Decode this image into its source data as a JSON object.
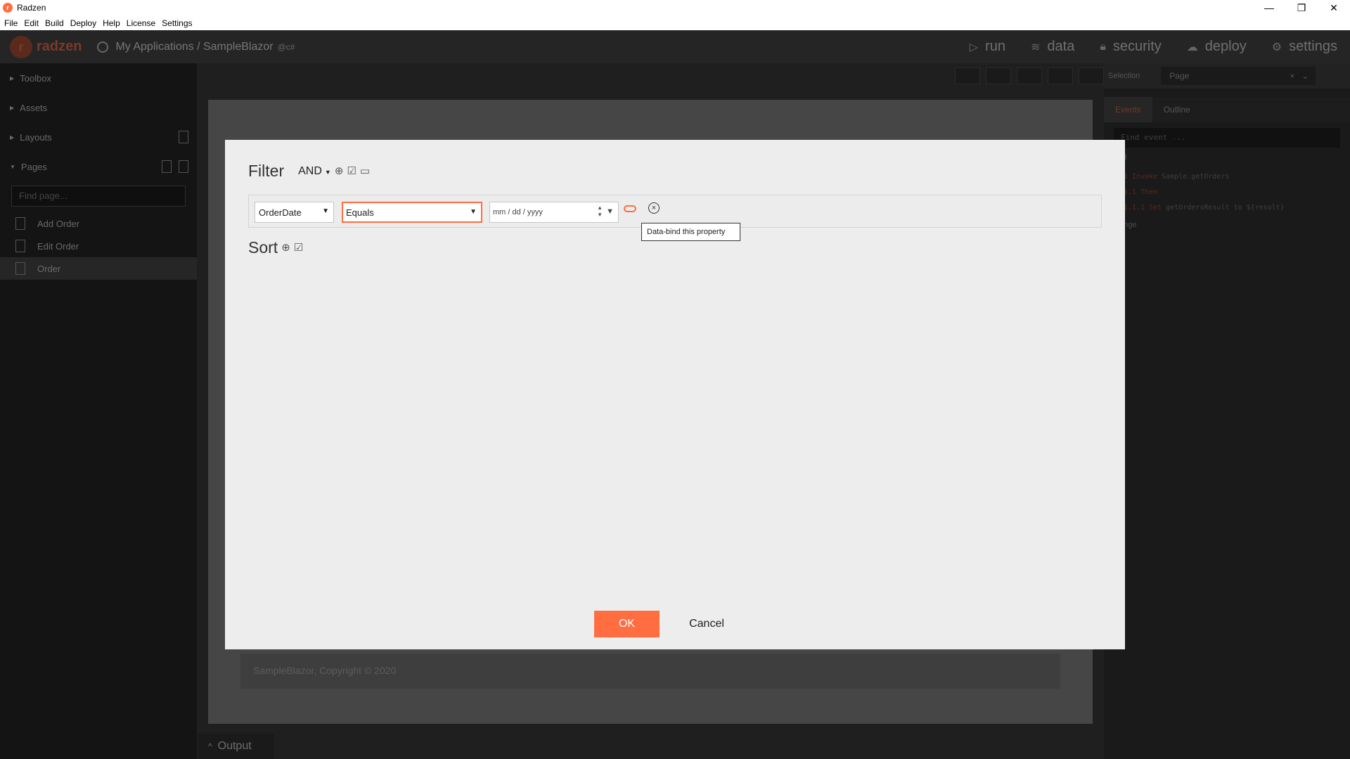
{
  "window": {
    "title": "Radzen",
    "controls": {
      "minimize": "—",
      "restore": "❐",
      "close": "✕"
    }
  },
  "menu": [
    "File",
    "Edit",
    "Build",
    "Deploy",
    "Help",
    "License",
    "Settings"
  ],
  "header": {
    "logo_text": "radzen",
    "breadcrumb": "My Applications / SampleBlazor",
    "language_tag": "@c#",
    "nav": [
      {
        "label": "run",
        "icon": "play-icon",
        "glyph": "▷"
      },
      {
        "label": "data",
        "icon": "layers-icon",
        "glyph": "≋"
      },
      {
        "label": "security",
        "icon": "lock-icon",
        "glyph": "🔒︎"
      },
      {
        "label": "deploy",
        "icon": "cloud-upload-icon",
        "glyph": "☁"
      },
      {
        "label": "settings",
        "icon": "gear-icon",
        "glyph": "⚙"
      }
    ]
  },
  "sidebar": {
    "sections": [
      "Toolbox",
      "Assets",
      "Layouts",
      "Pages"
    ],
    "find_page_placeholder": "Find page...",
    "pages": [
      "Add Order",
      "Edit Order",
      "Order"
    ]
  },
  "canvas": {
    "footer_text": "SampleBlazor, Copyright © 2020",
    "output_label": "Output"
  },
  "right_panel": {
    "selection_label": "Selection",
    "selection_value": "Page",
    "tabs": [
      "Events",
      "Outline"
    ],
    "find_event_placeholder": "Find event ...",
    "load_section": "Load",
    "change_section": "Change",
    "lines": [
      {
        "num": "1",
        "kw": "Invoke",
        "text": "Sample.getOrders"
      },
      {
        "num": "1.1",
        "kw": "Then",
        "text": ""
      },
      {
        "num": "1.1.1",
        "kw": "Set",
        "text": "getOrdersResult to ${result}"
      }
    ]
  },
  "dialog": {
    "filter_title": "Filter",
    "logic_operator": "AND",
    "filter_row": {
      "field": "OrderDate",
      "operator": "Equals",
      "value_placeholder": "mm / dd / yyyy"
    },
    "tooltip": "Data-bind this property",
    "sort_title": "Sort",
    "ok_label": "OK",
    "cancel_label": "Cancel"
  },
  "colors": {
    "accent": "#ff6d41",
    "dialog_bg": "#ededed"
  }
}
